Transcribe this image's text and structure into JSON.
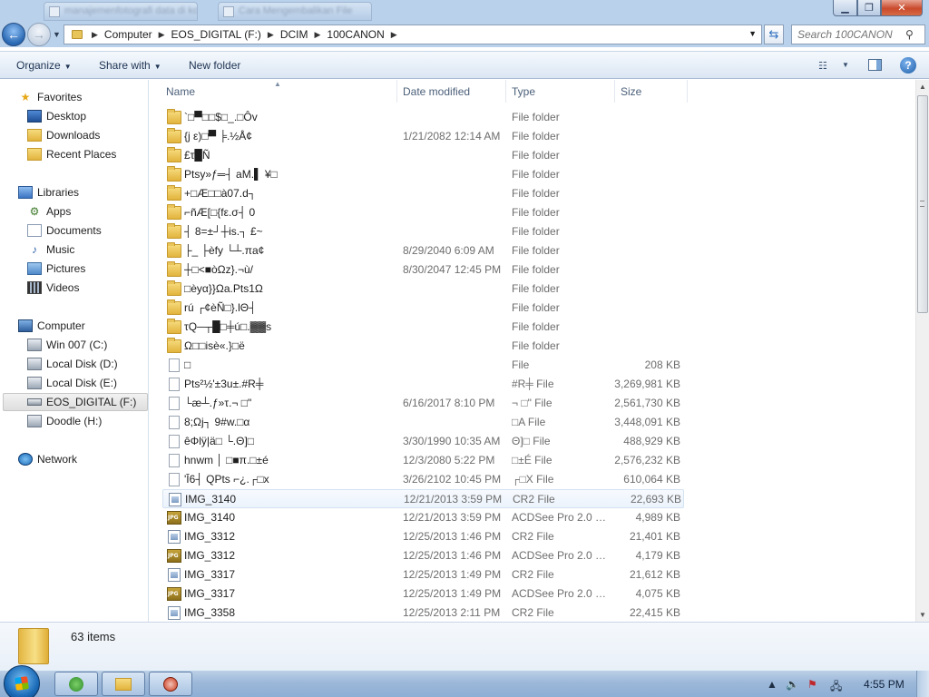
{
  "window": {
    "background_tabs": [
      "manajemenfotografi data di kom",
      "Cara Mengembalikan File"
    ]
  },
  "address": {
    "crumbs": [
      "Computer",
      "EOS_DIGITAL (F:)",
      "DCIM",
      "100CANON"
    ]
  },
  "search": {
    "placeholder": "Search 100CANON"
  },
  "commands": {
    "organize": "Organize",
    "share_with": "Share with",
    "new_folder": "New folder"
  },
  "nav": {
    "favorites": "Favorites",
    "desktop": "Desktop",
    "downloads": "Downloads",
    "recent_places": "Recent Places",
    "libraries": "Libraries",
    "apps": "Apps",
    "documents": "Documents",
    "music": "Music",
    "pictures": "Pictures",
    "videos": "Videos",
    "computer": "Computer",
    "win007": "Win 007 (C:)",
    "local_d": "Local Disk (D:)",
    "local_e": "Local Disk (E:)",
    "eos": "EOS_DIGITAL (F:)",
    "doodle": "Doodle (H:)",
    "network": "Network"
  },
  "columns": {
    "name": "Name",
    "date": "Date modified",
    "type": "Type",
    "size": "Size"
  },
  "files": [
    {
      "icon": "folder",
      "name": "`□▀□□$□_.□Ôv",
      "date": "",
      "type": "File folder",
      "size": ""
    },
    {
      "icon": "folder",
      "name": "{j ε)□▀ ╞.½Å¢",
      "date": "1/21/2082 12:14 AM",
      "type": "File folder",
      "size": ""
    },
    {
      "icon": "folder",
      "name": "£τ█Ñ",
      "date": "",
      "type": "File folder",
      "size": ""
    },
    {
      "icon": "folder",
      "name": "Ptsy»ƒ═┤ aM.▌ ¥□",
      "date": "",
      "type": "File folder",
      "size": ""
    },
    {
      "icon": "folder",
      "name": "+□Æ□□à07.d┐",
      "date": "",
      "type": "File folder",
      "size": ""
    },
    {
      "icon": "folder",
      "name": "⌐ñÆ[□{fε.σ┤ 0",
      "date": "",
      "type": "File folder",
      "size": ""
    },
    {
      "icon": "folder",
      "name": "┤ 8=±┘┼is.┐ £~",
      "date": "",
      "type": "File folder",
      "size": ""
    },
    {
      "icon": "folder",
      "name": "├_ ├èfy └┴.πa¢",
      "date": "8/29/2040 6:09 AM",
      "type": "File folder",
      "size": ""
    },
    {
      "icon": "folder",
      "name": "┼□<■òΩz}.¬ù/",
      "date": "8/30/2047 12:45 PM",
      "type": "File folder",
      "size": ""
    },
    {
      "icon": "folder",
      "name": "□èyα}}Ωa.Pts1Ω",
      "date": "",
      "type": "File folder",
      "size": ""
    },
    {
      "icon": "folder",
      "name": "rú ┌¢èÑ□}.lΘ┤",
      "date": "",
      "type": "File folder",
      "size": ""
    },
    {
      "icon": "folder",
      "name": "τQ─┬█□╪ú□.▓▓s",
      "date": "",
      "type": "File folder",
      "size": ""
    },
    {
      "icon": "folder",
      "name": "Ω□□isè«.}□ë",
      "date": "",
      "type": "File folder",
      "size": ""
    },
    {
      "icon": "file",
      "name": "□",
      "date": "",
      "type": "File",
      "size": "208 KB"
    },
    {
      "icon": "file",
      "name": "Pts²½'±3u±.#R╪",
      "date": "",
      "type": "#R╪ File",
      "size": "3,269,981 KB"
    },
    {
      "icon": "file",
      "name": "└æ┴.ƒ»τ.¬ □\"",
      "date": "6/16/2017 8:10 PM",
      "type": "¬ □\" File",
      "size": "2,561,730 KB"
    },
    {
      "icon": "file",
      "name": "8;Ωj┐ 9#w.□α",
      "date": "",
      "type": "□A File",
      "size": "3,448,091 KB"
    },
    {
      "icon": "file",
      "name": "êΦlÿ|ä□ └.Θ]□",
      "date": "3/30/1990 10:35 AM",
      "type": "Θ]□ File",
      "size": "488,929 KB"
    },
    {
      "icon": "file",
      "name": "hnwm │ □■π.□±é",
      "date": "12/3/2080 5:22 PM",
      "type": "□±É File",
      "size": "2,576,232 KB"
    },
    {
      "icon": "file",
      "name": "'Ī6┤ QPts ⌐¿.┌□x",
      "date": "3/26/2102 10:45 PM",
      "type": "┌□X File",
      "size": "610,064 KB"
    },
    {
      "icon": "cr2",
      "name": "IMG_3140",
      "date": "12/21/2013 3:59 PM",
      "type": "CR2 File",
      "size": "22,693 KB"
    },
    {
      "icon": "jpg",
      "name": "IMG_3140",
      "date": "12/21/2013 3:59 PM",
      "type": "ACDSee Pro 2.0 JP...",
      "size": "4,989 KB"
    },
    {
      "icon": "cr2",
      "name": "IMG_3312",
      "date": "12/25/2013 1:46 PM",
      "type": "CR2 File",
      "size": "21,401 KB"
    },
    {
      "icon": "jpg",
      "name": "IMG_3312",
      "date": "12/25/2013 1:46 PM",
      "type": "ACDSee Pro 2.0 JP...",
      "size": "4,179 KB"
    },
    {
      "icon": "cr2",
      "name": "IMG_3317",
      "date": "12/25/2013 1:49 PM",
      "type": "CR2 File",
      "size": "21,612 KB"
    },
    {
      "icon": "jpg",
      "name": "IMG_3317",
      "date": "12/25/2013 1:49 PM",
      "type": "ACDSee Pro 2.0 JP...",
      "size": "4,075 KB"
    },
    {
      "icon": "cr2",
      "name": "IMG_3358",
      "date": "12/25/2013 2:11 PM",
      "type": "CR2 File",
      "size": "22,415 KB"
    }
  ],
  "status": {
    "item_count": "63 items"
  },
  "taskbar": {
    "clock": "4:55 PM"
  }
}
